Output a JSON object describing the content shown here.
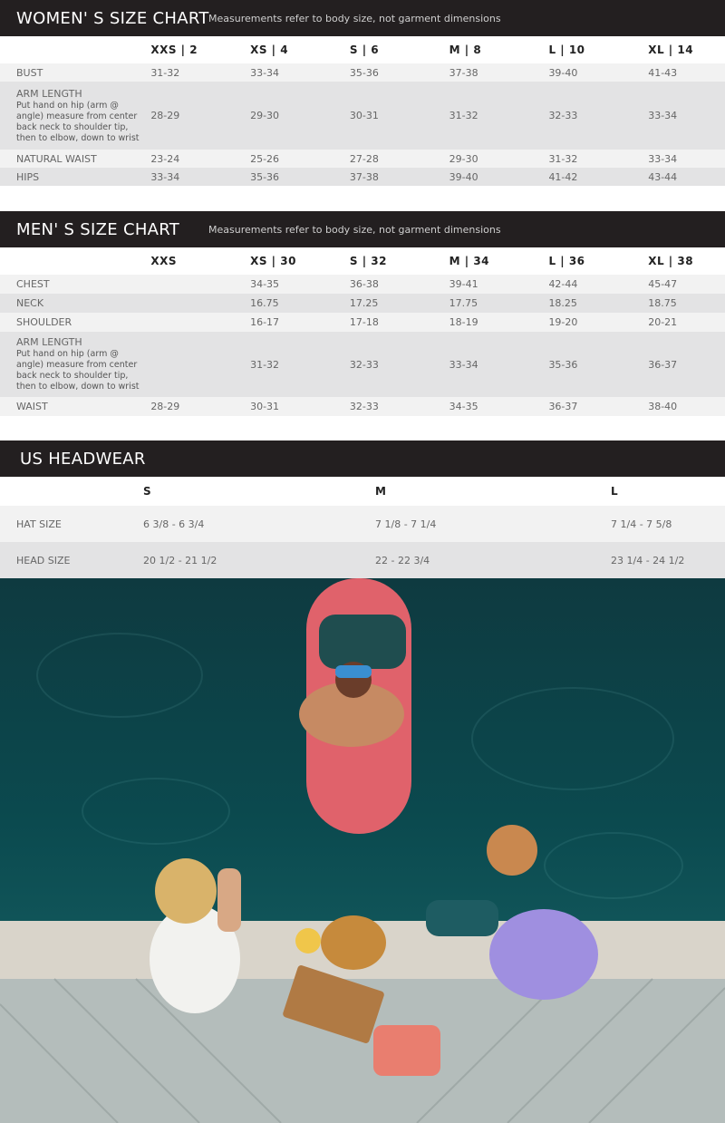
{
  "women": {
    "title": "WOMEN' S SIZE CHART",
    "note": "Measurements refer to body size, not garment dimensions",
    "sizes": [
      "XXS | 2",
      "XS | 4",
      "S | 6",
      "M | 8",
      "L | 10",
      "XL | 14"
    ],
    "rows": [
      {
        "label": "BUST",
        "values": [
          "31-32",
          "33-34",
          "35-36",
          "37-38",
          "39-40",
          "41-43"
        ]
      },
      {
        "label": "ARM LENGTH",
        "desc": "Put hand on hip (arm @ angle) measure from center back neck to shoulder tip, then to elbow, down to wrist",
        "values": [
          "28-29",
          "29-30",
          "30-31",
          "31-32",
          "32-33",
          "33-34"
        ]
      },
      {
        "label": "NATURAL WAIST",
        "values": [
          "23-24",
          "25-26",
          "27-28",
          "29-30",
          "31-32",
          "33-34"
        ]
      },
      {
        "label": "HIPS",
        "values": [
          "33-34",
          "35-36",
          "37-38",
          "39-40",
          "41-42",
          "43-44"
        ]
      }
    ]
  },
  "men": {
    "title": "MEN' S SIZE CHART",
    "note": "Measurements refer to body size, not garment dimensions",
    "sizes": [
      "XXS",
      "XS | 30",
      "S | 32",
      "M | 34",
      "L | 36",
      "XL | 38"
    ],
    "rows": [
      {
        "label": "CHEST",
        "values": [
          "",
          "34-35",
          "36-38",
          "39-41",
          "42-44",
          "45-47"
        ]
      },
      {
        "label": "NECK",
        "values": [
          "",
          "16.75",
          "17.25",
          "17.75",
          "18.25",
          "18.75"
        ]
      },
      {
        "label": "SHOULDER",
        "values": [
          "",
          "16-17",
          "17-18",
          "18-19",
          "19-20",
          "20-21"
        ]
      },
      {
        "label": "ARM LENGTH",
        "desc": "Put hand on hip (arm @ angle) measure from center back neck to shoulder tip, then to elbow, down to wrist",
        "values": [
          "",
          "31-32",
          "32-33",
          "33-34",
          "35-36",
          "36-37"
        ]
      },
      {
        "label": "WAIST",
        "values": [
          "28-29",
          "30-31",
          "32-33",
          "34-35",
          "36-37",
          "38-40"
        ]
      }
    ]
  },
  "headwear": {
    "title": "US HEADWEAR",
    "sizes": [
      "S",
      "M",
      "L"
    ],
    "rows": [
      {
        "label": "HAT SIZE",
        "values": [
          "6 3/8 - 6 3/4",
          "7 1/8 - 7 1/4",
          "7 1/4 - 7 5/8"
        ]
      },
      {
        "label": "HEAD SIZE",
        "values": [
          "20 1/2 - 21 1/2",
          "22 - 22 3/4",
          "23 1/4 - 24 1/2"
        ]
      }
    ]
  },
  "colors": {
    "header_bar": "#231f20",
    "row_light": "#f2f2f2",
    "row_dark": "#e3e3e4",
    "surfboard": "#e0626b",
    "water": "#0b4a4f"
  }
}
